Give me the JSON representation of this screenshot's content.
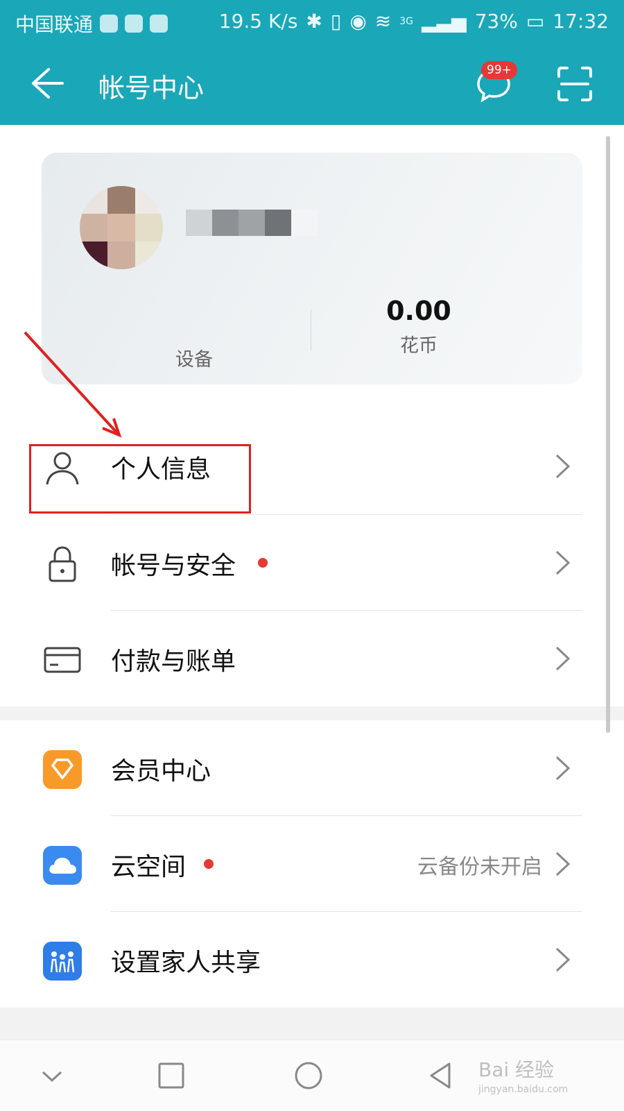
{
  "status_bar": {
    "carrier": "中国联通",
    "speed": "19.5 K/s",
    "network": "3G",
    "battery": "73%",
    "time": "17:32"
  },
  "app_bar": {
    "title": "帐号中心",
    "message_badge": "99+"
  },
  "profile_card": {
    "devices_label": "设备",
    "coins_value": "0.00",
    "coins_label": "花币"
  },
  "menu": {
    "personal_info": "个人信息",
    "account_security": "帐号与安全",
    "payment_billing": "付款与账单",
    "member_center": "会员中心",
    "cloud_space": "云空间",
    "cloud_space_status": "云备份未开启",
    "family_sharing": "设置家人共享"
  },
  "watermark": {
    "text": "Bai 经验",
    "url": "jingyan.baidu.com"
  },
  "colors": {
    "accent": "#1aa7b8",
    "badge_red": "#e53935",
    "highlight_red": "#e02020"
  }
}
